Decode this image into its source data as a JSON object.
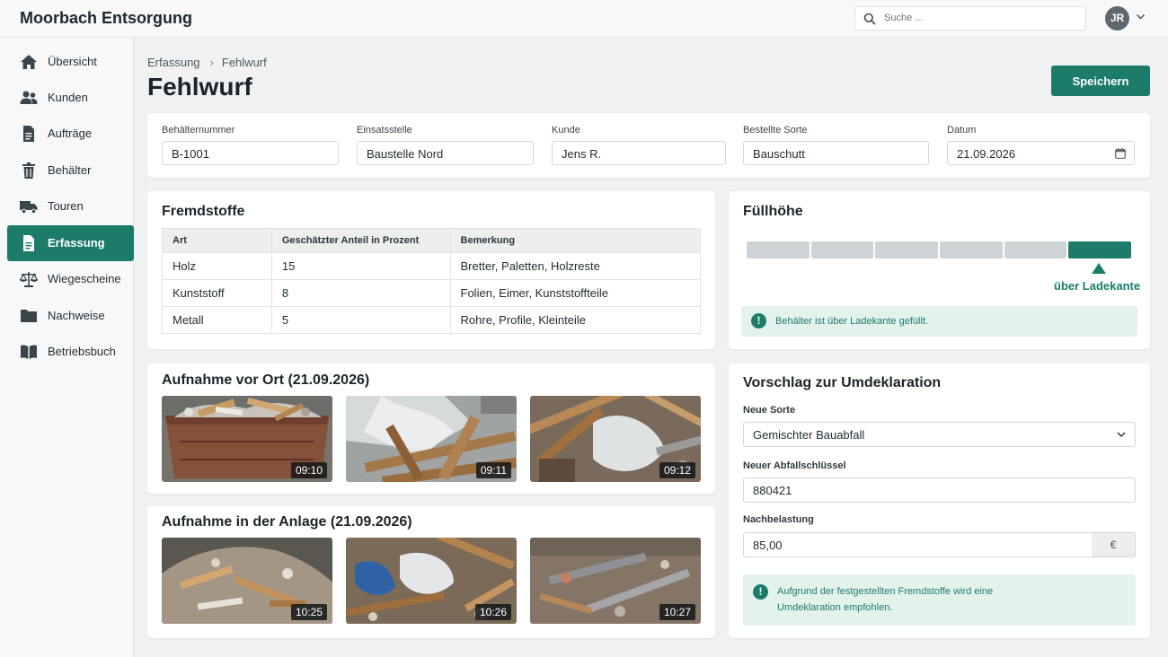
{
  "app": {
    "title": "Moorbach Entsorgung"
  },
  "search": {
    "placeholder": "Suche ..."
  },
  "user": {
    "initials": "JR"
  },
  "sidebar": {
    "items": [
      {
        "label": "Übersicht",
        "icon": "home-icon"
      },
      {
        "label": "Kunden",
        "icon": "users-icon"
      },
      {
        "label": "Aufträge",
        "icon": "document-icon"
      },
      {
        "label": "Behälter",
        "icon": "bin-icon"
      },
      {
        "label": "Touren",
        "icon": "truck-icon"
      },
      {
        "label": "Erfassung",
        "icon": "form-icon",
        "active": true
      },
      {
        "label": "Wiegescheine",
        "icon": "scale-icon"
      },
      {
        "label": "Nachweise",
        "icon": "folder-icon"
      },
      {
        "label": "Betriebsbuch",
        "icon": "book-icon"
      }
    ]
  },
  "breadcrumb": {
    "parent": "Erfassung",
    "current": "Fehlwurf"
  },
  "page": {
    "title": "Fehlwurf",
    "save_label": "Speichern"
  },
  "fields": {
    "container": {
      "label": "Behälternummer",
      "value": "B-1001"
    },
    "site": {
      "label": "Einsatsstelle",
      "value": "Baustelle Nord"
    },
    "customer": {
      "label": "Kunde",
      "value": "Jens R."
    },
    "ordered": {
      "label": "Bestellte Sorte",
      "value": "Bauschutt"
    },
    "date": {
      "label": "Datum",
      "value": "21.09.2026"
    }
  },
  "foreign": {
    "title": "Fremdstoffe",
    "headers": [
      "Art",
      "Geschätzter Anteil in Prozent",
      "Bemerkung"
    ],
    "rows": [
      [
        "Holz",
        "15",
        "Bretter, Paletten, Holzreste"
      ],
      [
        "Kunststoff",
        "8",
        "Folien, Eimer, Kunststoffteile"
      ],
      [
        "Metall",
        "5",
        "Rohre, Profile, Kleinteile"
      ]
    ]
  },
  "fill": {
    "title": "Füllhöhe",
    "segments": 6,
    "level": 6,
    "marker_label": "über Ladekante",
    "alert": "Behälter ist über Ladekante gefüllt."
  },
  "photos_site": {
    "title": "Aufnahme vor Ort (21.09.2026)",
    "times": [
      "09:10",
      "09:11",
      "09:12"
    ]
  },
  "photos_plant": {
    "title": "Aufnahme in der Anlage (21.09.2026)",
    "times": [
      "10:25",
      "10:26",
      "10:27"
    ]
  },
  "reclass": {
    "title": "Vorschlag zur Umdeklaration",
    "sort_label": "Neue Sorte",
    "sort_value": "Gemischter Bauabfall",
    "key_label": "Neuer Abfallschlüssel",
    "key_value": "880421",
    "charge_label": "Nachbelastung",
    "charge_value": "85,00",
    "charge_unit": "€",
    "alert": "Aufgrund der festgestellten Fremdstoffe wird eine Umdeklaration empfohlen."
  },
  "colors": {
    "accent": "#1c7c69",
    "alert_bg": "#e4f2ee"
  }
}
